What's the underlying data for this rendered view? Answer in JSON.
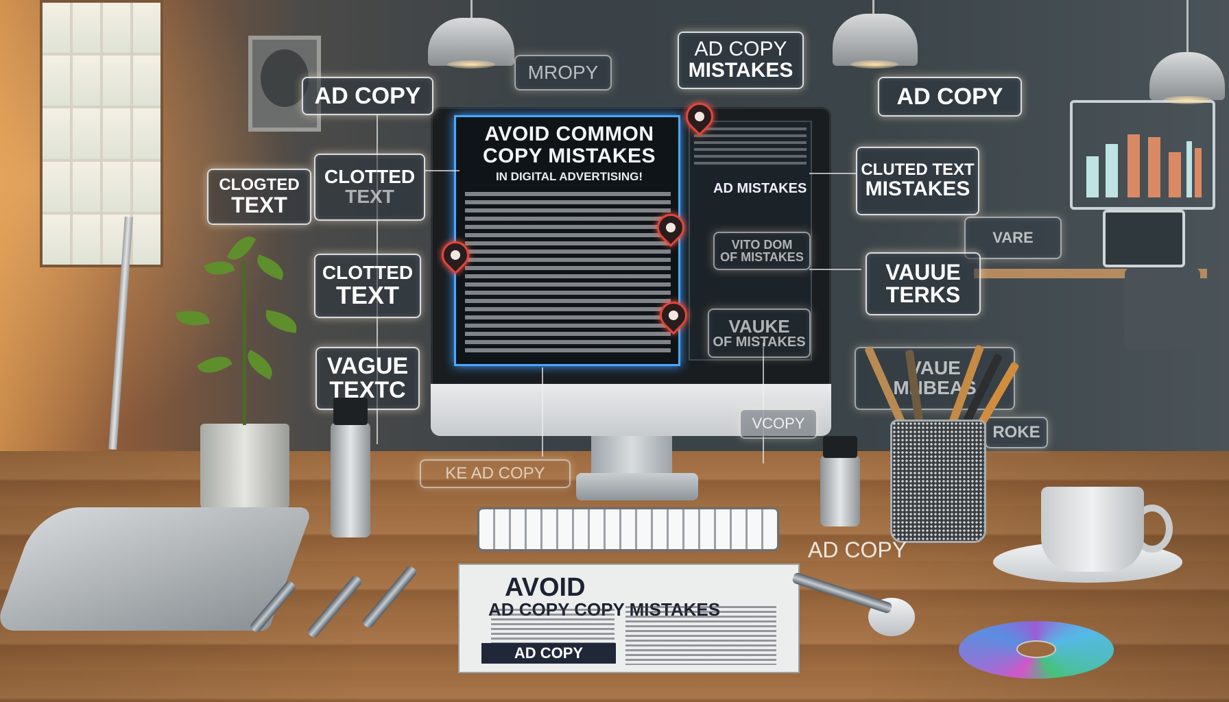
{
  "scene": {
    "description": "Office desk with computer monitor showing ad copy mistakes, surrounded by floating holographic labels",
    "colors": {
      "screen_glow": "#3b9cff",
      "marker_pin": "#e2463a",
      "label_border": "#ebf0f5",
      "desk_wood": "#9c6a3e"
    }
  },
  "monitor": {
    "headline_line1": "AVOID COMMON",
    "headline_line2": "COPY MISTAKES",
    "subheadline": "IN DIGITAL ADVERTISING!",
    "side_panel_label": "AD MISTAKES"
  },
  "floating_labels": [
    {
      "id": "ad-copy-left",
      "line1": "AD COPY",
      "line2": ""
    },
    {
      "id": "mropy",
      "line1": "MROPY",
      "line2": ""
    },
    {
      "id": "ad-copy-mistakes-top",
      "line1": "AD COPY",
      "line2": "MISTAKES"
    },
    {
      "id": "ad-copy-right",
      "line1": "AD COPY",
      "line2": ""
    },
    {
      "id": "clogted-text",
      "line1": "CLOGTED",
      "line2": "TEXT"
    },
    {
      "id": "clotted-text-upper",
      "line1": "CLOTTED",
      "line2": "TEXT"
    },
    {
      "id": "clotted-text-lower",
      "line1": "CLOTTED",
      "line2": "TEXT"
    },
    {
      "id": "vague-text",
      "line1": "VAGUE",
      "line2": "TEXTC"
    },
    {
      "id": "cluted-text-mistakes",
      "line1": "CLUTED TEXT",
      "line2": "MISTAKES"
    },
    {
      "id": "vare",
      "line1": "VARE",
      "line2": ""
    },
    {
      "id": "vito-dom",
      "line1": "VITO DOM",
      "line2": "OF MISTAKES"
    },
    {
      "id": "vague-terks",
      "line1": "VAUUE",
      "line2": "TERKS"
    },
    {
      "id": "vauke",
      "line1": "VAUKE",
      "line2": "OF MISTAKES"
    },
    {
      "id": "vaue-mnbeas",
      "line1": "VAUE",
      "line2": "MNBEAS"
    },
    {
      "id": "vcopy",
      "line1": "VCOPY",
      "line2": ""
    },
    {
      "id": "roke",
      "line1": "ROKE",
      "line2": ""
    },
    {
      "id": "ke-ad-copy",
      "line1": "KE AD COPY",
      "line2": ""
    }
  ],
  "desk_text": {
    "ad_copy_engraving": "AD COPY"
  },
  "paper": {
    "title": "AVOID",
    "subtitle": "AD COPY COPY MISTAKES",
    "badge": "AD COPY"
  }
}
